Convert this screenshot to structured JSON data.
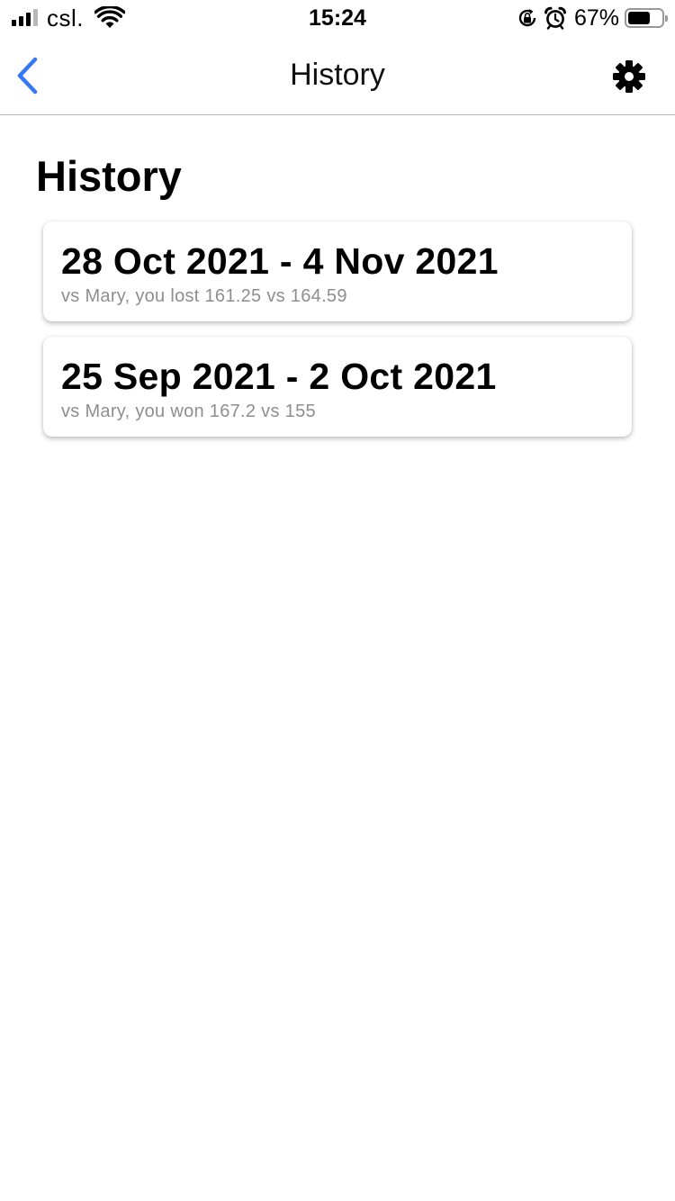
{
  "status_bar": {
    "carrier": "csl.",
    "time": "15:24",
    "battery_percent": "67%",
    "battery_level": 0.67,
    "signal_bars_active": 3,
    "signal_bars_total": 4,
    "icons": [
      "signal-icon",
      "wifi-icon",
      "rotation-lock-icon",
      "alarm-icon",
      "battery-icon"
    ]
  },
  "nav": {
    "title": "History",
    "back_icon": "chevron-left-icon",
    "settings_icon": "gear-icon",
    "accent_color": "#3478f6"
  },
  "main": {
    "heading": "History",
    "items": [
      {
        "title": "28 Oct 2021 - 4 Nov 2021",
        "subtitle": "vs Mary, you lost 161.25 vs 164.59"
      },
      {
        "title": "25 Sep 2021 - 2 Oct 2021",
        "subtitle": "vs Mary, you won 167.2 vs 155"
      }
    ]
  }
}
